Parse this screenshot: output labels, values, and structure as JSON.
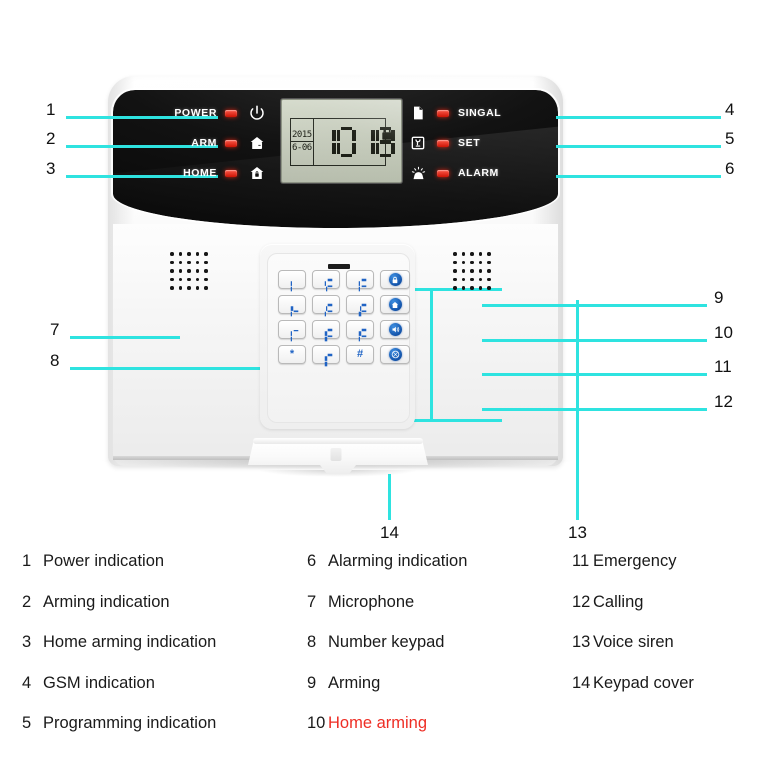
{
  "device": {
    "name": "gsm-alarm-panel",
    "status_leds_left": [
      {
        "label": "POWER",
        "icon": "power-icon",
        "led_color": "#e01a06"
      },
      {
        "label": "ARM",
        "icon": "house-shield-icon",
        "led_color": "#e01a06"
      },
      {
        "label": "HOME",
        "icon": "house-lock-icon",
        "led_color": "#e01a06"
      }
    ],
    "status_leds_right": [
      {
        "label": "SINGAL",
        "icon": "sim-card-icon",
        "led_color": "#e01a06"
      },
      {
        "label": "SET",
        "icon": "wrench-box-icon",
        "led_color": "#e01a06"
      },
      {
        "label": "ALARM",
        "icon": "siren-icon",
        "led_color": "#e01a06"
      }
    ],
    "lcd": {
      "year": "2015",
      "date": "6-06",
      "hours": "10",
      "minutes": "18",
      "lock_icon": "padlock-icon"
    },
    "keypad": {
      "rows": [
        [
          "1",
          "2",
          "3"
        ],
        [
          "4",
          "5",
          "6"
        ],
        [
          "7",
          "8",
          "9"
        ],
        [
          "*",
          "0",
          "#"
        ]
      ]
    },
    "function_keys": [
      {
        "icon": "arming-lock-icon"
      },
      {
        "icon": "home-arming-house-icon"
      },
      {
        "icon": "speaker-voice-icon"
      },
      {
        "icon": "emergency-sos-icon"
      }
    ],
    "grilles": [
      {
        "name": "microphone-grille",
        "rows": 5,
        "cols": 5
      },
      {
        "name": "voice-siren-grille",
        "rows": 5,
        "cols": 5
      }
    ],
    "cover": {
      "name": "keypad-cover"
    }
  },
  "callouts": {
    "accent_color": "#2ee3e0",
    "numbers": [
      "1",
      "2",
      "3",
      "4",
      "5",
      "6",
      "7",
      "8",
      "9",
      "10",
      "11",
      "12",
      "13",
      "14"
    ]
  },
  "legend": {
    "highlight_color": "#ee2d24",
    "columns": [
      [
        {
          "n": "1",
          "text": "Power indication",
          "highlight": false
        },
        {
          "n": "2",
          "text": "Arming indication",
          "highlight": false
        },
        {
          "n": "3",
          "text": "Home arming indication",
          "highlight": false
        },
        {
          "n": "4",
          "text": "GSM indication",
          "highlight": false
        },
        {
          "n": "5",
          "text": "Programming indication",
          "highlight": false
        }
      ],
      [
        {
          "n": "6",
          "text": "Alarming indication",
          "highlight": false
        },
        {
          "n": "7",
          "text": "Microphone",
          "highlight": false
        },
        {
          "n": "8",
          "text": "Number keypad",
          "highlight": false
        },
        {
          "n": "9",
          "text": "Arming",
          "highlight": false
        },
        {
          "n": "10",
          "text": "Home arming",
          "highlight": true
        }
      ],
      [
        {
          "n": "11",
          "text": "Emergency",
          "highlight": false
        },
        {
          "n": "12",
          "text": "Calling",
          "highlight": false
        },
        {
          "n": "13",
          "text": "Voice siren",
          "highlight": false
        },
        {
          "n": "14",
          "text": "Keypad cover",
          "highlight": false
        }
      ]
    ]
  }
}
